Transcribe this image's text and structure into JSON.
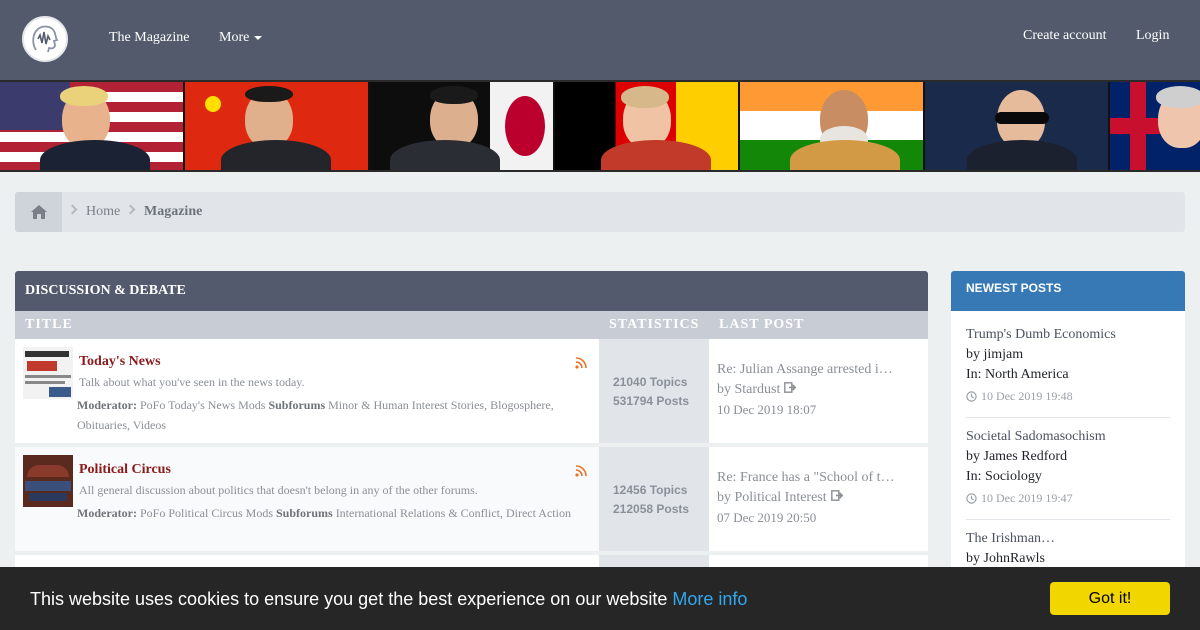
{
  "nav": {
    "logo_icon": "head-wave-logo-icon",
    "links": [
      "The Magazine",
      "More",
      "Create account",
      "Login"
    ]
  },
  "breadcrumb": {
    "home_icon": "home-icon",
    "items": [
      "Home",
      "Magazine"
    ]
  },
  "forum": {
    "section_title": "DISCUSSION & DEBATE",
    "columns": [
      "TITLE",
      "STATISTICS",
      "LAST POST"
    ],
    "rows": [
      {
        "title": "Today's News",
        "description": "Talk about what you've seen in the news today.",
        "moderator_label": "Moderator:",
        "moderator": "PoFo Today's News Mods",
        "subforums_label": "Subforums",
        "subforums": "Minor & Human Interest Stories, Blogosphere, Obituaries, Videos",
        "topics": "21040 Topics",
        "posts": "531794 Posts",
        "last_title": "Re: Julian Assange arrested i…",
        "last_by_label": "by",
        "last_by": "Stardust",
        "last_date": "10 Dec 2019 18:07"
      },
      {
        "title": "Political Circus",
        "description": "All general discussion about politics that doesn't belong in any of the other forums.",
        "moderator_label": "Moderator:",
        "moderator": "PoFo Political Circus Mods",
        "subforums_label": "Subforums",
        "subforums": "International Relations & Conflict, Direct Action",
        "topics": "12456 Topics",
        "posts": "212058 Posts",
        "last_title": "Re: France has a \"School of t…",
        "last_by_label": "by",
        "last_by": "Political Interest",
        "last_date": "07 Dec 2019 20:50"
      }
    ]
  },
  "sidebar": {
    "title": "NEWEST POSTS",
    "posts": [
      {
        "title": "Trump's Dumb Economics",
        "by": "by jimjam",
        "in": "In: North America",
        "date": "10 Dec 2019 19:48"
      },
      {
        "title": "Societal Sadomasochism",
        "by": "by James Redford",
        "in": "In: Sociology",
        "date": "10 Dec 2019 19:47"
      },
      {
        "title": "The Irishman…",
        "by": "by JohnRawls"
      }
    ]
  },
  "cookie": {
    "text": "This website uses cookies to ensure you get the best experience on our website",
    "link": "More info",
    "button": "Got it!"
  },
  "colors": {
    "nav_bg": "#535a6c",
    "forum_title": "#8b1a1a",
    "sidebar_header": "#3679b5",
    "cookie_button": "#f1d600",
    "cookie_link": "#31a8f0"
  }
}
